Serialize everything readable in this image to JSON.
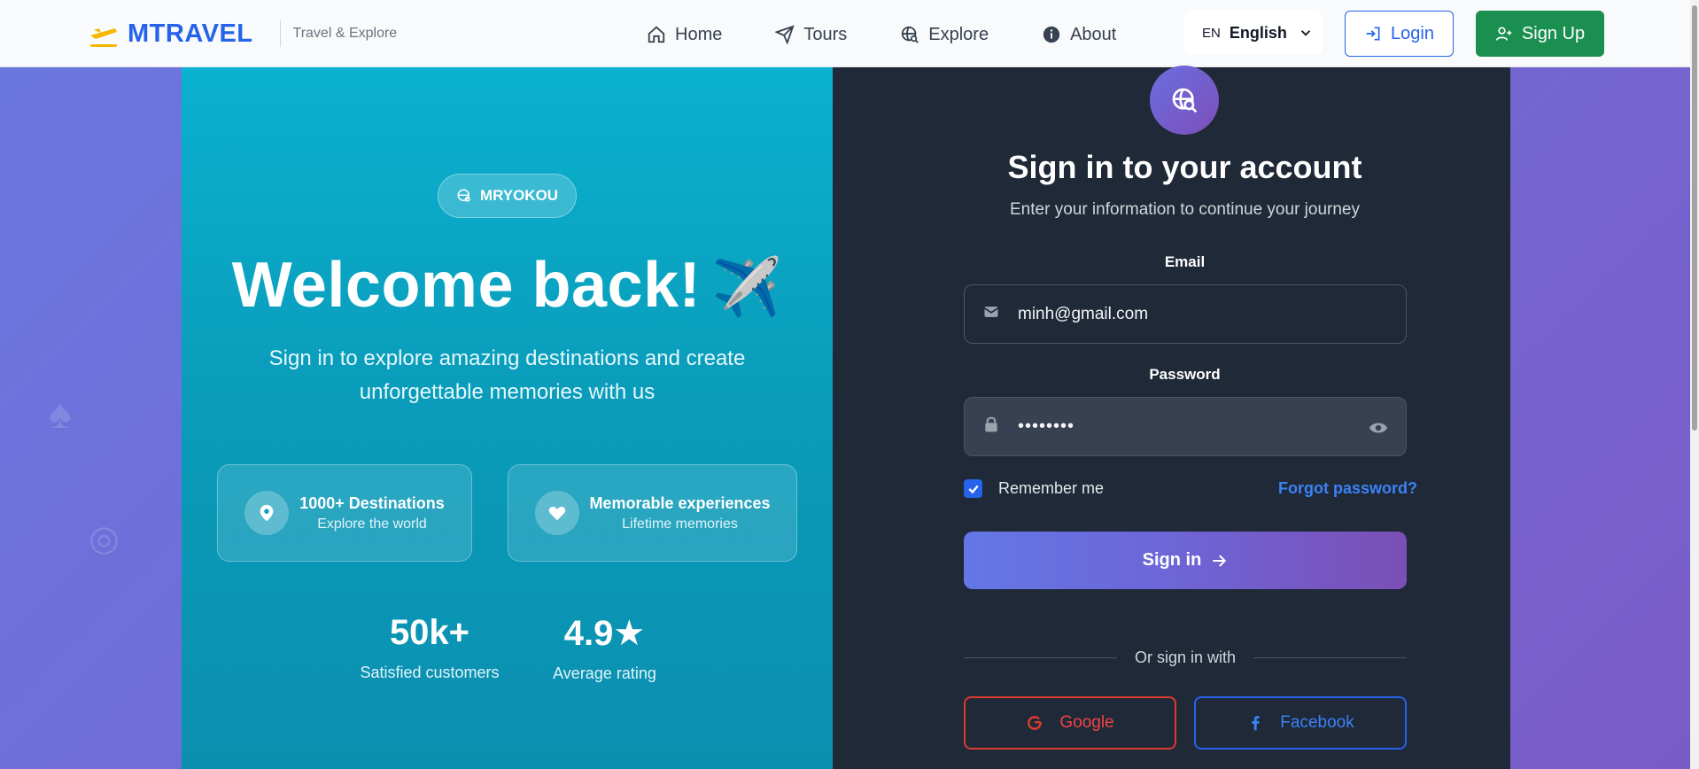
{
  "header": {
    "brand_name": "MTRAVEL",
    "brand_tagline": "Travel & Explore",
    "nav": [
      {
        "label": "Home",
        "icon": "home-icon"
      },
      {
        "label": "Tours",
        "icon": "send-icon"
      },
      {
        "label": "Explore",
        "icon": "globe-search-icon"
      },
      {
        "label": "About",
        "icon": "info-icon"
      }
    ],
    "language": {
      "code": "EN",
      "name": "English"
    },
    "login_label": "Login",
    "signup_label": "Sign Up"
  },
  "hero": {
    "badge": "MRYOKOU",
    "title": "Welcome back!",
    "plane_emoji": "✈️",
    "subtitle": "Sign in to explore amazing destinations and create unforgettable memories with us",
    "features": [
      {
        "title": "1000+ Destinations",
        "subtitle": "Explore the world",
        "icon": "map-pin-icon"
      },
      {
        "title": "Memorable experiences",
        "subtitle": "Lifetime memories",
        "icon": "heart-icon"
      }
    ],
    "stats": [
      {
        "value": "50k+",
        "label": "Satisfied customers"
      },
      {
        "value": "4.9★",
        "label": "Average rating"
      }
    ]
  },
  "signin": {
    "title": "Sign in to your account",
    "subtitle": "Enter your information to continue your journey",
    "email_label": "Email",
    "email_value": "minh@gmail.com",
    "password_label": "Password",
    "password_masked": "••••••••",
    "remember_label": "Remember me",
    "remember_checked": true,
    "forgot_label": "Forgot password?",
    "submit_label": "Sign in",
    "divider_text": "Or sign in with",
    "google_label": "Google",
    "facebook_label": "Facebook"
  },
  "colors": {
    "brand_blue": "#2563eb",
    "signup_green": "#1b8f4f",
    "hero_teal": "#0a9dbb",
    "panel_dark": "#1f2937",
    "google_red": "#dc3a2f"
  }
}
